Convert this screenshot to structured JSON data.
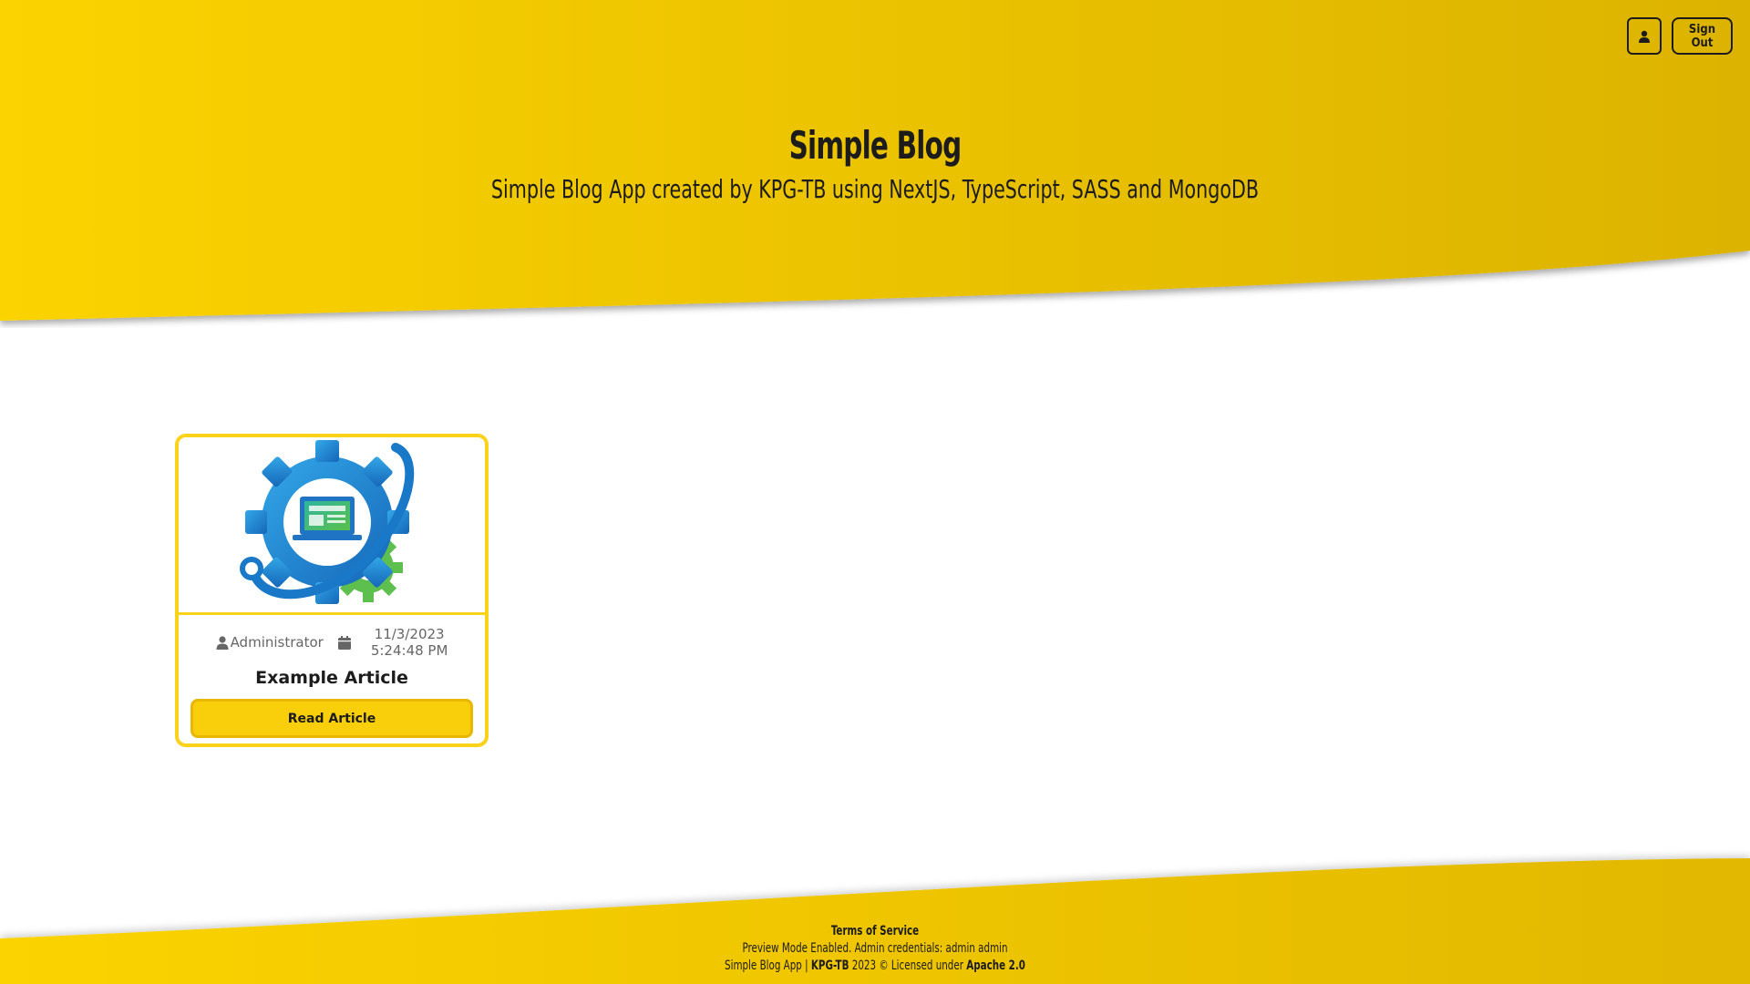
{
  "header": {
    "title": "Simple Blog",
    "subtitle": "Simple Blog App created by KPG-TB using NextJS, TypeScript, SASS and MongoDB",
    "profile_icon": "user-icon",
    "sign_out_label": "Sign Out"
  },
  "colors": {
    "brand_yellow": "#f9cf0b",
    "brand_yellow_dark": "#dcb300",
    "text_dark": "#1c1c1c"
  },
  "articles": [
    {
      "image_icon": "gear-computer-logo-icon",
      "author": "Administrator",
      "date": "11/3/2023",
      "time": "5:24:48 PM",
      "title": "Example Article",
      "read_label": "Read Article"
    }
  ],
  "footer": {
    "terms_label": "Terms of Service",
    "preview_notice": "Preview Mode Enabled. Admin credentials: admin admin",
    "app_name": "Simple Blog App |",
    "author_link": "KPG-TB",
    "year_text": "2023 © Licensed under",
    "license_link": "Apache 2.0"
  }
}
